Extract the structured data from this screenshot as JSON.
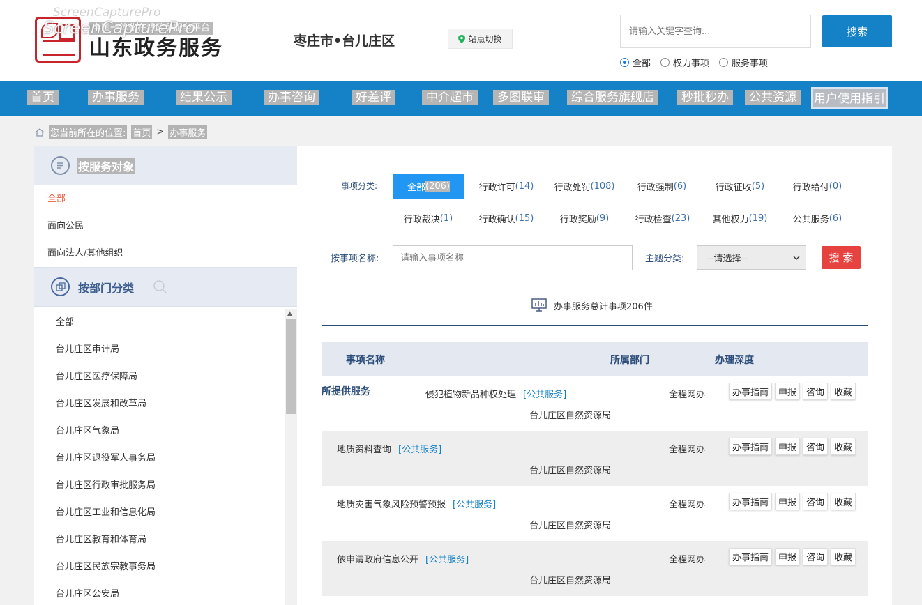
{
  "header": {
    "watermark_top": "ScreenCapturePro",
    "watermark": "ScreenCapturePro",
    "logo_subtitle": "全国一体化在线政务服务平台",
    "logo_title": "山东政务服务",
    "region": "枣庄市•台儿庄区",
    "site_switch": "站点切换",
    "search_placeholder": "请输入关键字查询...",
    "search_button": "搜索",
    "radios": [
      {
        "label": "全部",
        "checked": true
      },
      {
        "label": "权力事项",
        "checked": false
      },
      {
        "label": "服务事项",
        "checked": false
      }
    ]
  },
  "nav": {
    "items": [
      "首页",
      "办事服务",
      "结果公示",
      "办事咨询",
      "好差评",
      "中介超市",
      "多图联审",
      "综合服务旗舰店",
      "秒批秒办",
      "公共资源"
    ],
    "guide": "用户使用指引"
  },
  "breadcrumb": {
    "prefix": "您当前所在的位置:",
    "home": "首页",
    "sep": ">",
    "current": "办事服务"
  },
  "sidebar": {
    "target_title": "按服务对象",
    "target_items": [
      "全部",
      "面向公民",
      "面向法人/其他组织"
    ],
    "dept_title": "按部门分类",
    "dept_items": [
      "全部",
      "台儿庄区审计局",
      "台儿庄区医疗保障局",
      "台儿庄区发展和改革局",
      "台儿庄区气象局",
      "台儿庄区退役军人事务局",
      "台儿庄区行政审批服务局",
      "台儿庄区工业和信息化局",
      "台儿庄区教育和体育局",
      "台儿庄区民族宗教事务局",
      "台儿庄区公安局"
    ]
  },
  "filters": {
    "category_label": "事项分类:",
    "categories_row1": [
      {
        "name": "全部",
        "count": "(206)"
      },
      {
        "name": "行政许可",
        "count": "(14)"
      },
      {
        "name": "行政处罚",
        "count": "(108)"
      },
      {
        "name": "行政强制",
        "count": "(6)"
      },
      {
        "name": "行政征收",
        "count": "(5)"
      },
      {
        "name": "行政给付",
        "count": "(0)"
      }
    ],
    "categories_row2": [
      {
        "name": "行政裁决",
        "count": "(1)"
      },
      {
        "name": "行政确认",
        "count": "(15)"
      },
      {
        "name": "行政奖励",
        "count": "(9)"
      },
      {
        "name": "行政检查",
        "count": "(23)"
      },
      {
        "name": "其他权力",
        "count": "(19)"
      },
      {
        "name": "公共服务",
        "count": "(6)"
      }
    ],
    "name_label": "按事项名称:",
    "name_placeholder": "请输入事项名称",
    "theme_label": "主题分类:",
    "theme_value": "--请选择--",
    "search_button": "搜 索"
  },
  "summary": {
    "total_text": "办事服务总计事项206件"
  },
  "table": {
    "columns": [
      "事项名称",
      "所属部门",
      "办理深度"
    ],
    "section_label": "所提供服务",
    "rows": [
      {
        "name": "侵犯植物新品种权处理",
        "tag": "[公共服务]",
        "dept": "台儿庄区自然资源局",
        "depth": "全程网办"
      },
      {
        "name": "地质资料查询",
        "tag": "[公共服务]",
        "dept": "台儿庄区自然资源局",
        "depth": "全程网办"
      },
      {
        "name": "地质灾害气象风险预警预报",
        "tag": "[公共服务]",
        "dept": "台儿庄区自然资源局",
        "depth": "全程网办"
      },
      {
        "name": "依申请政府信息公开",
        "tag": "[公共服务]",
        "dept": "台儿庄区自然资源局",
        "depth": "全程网办"
      }
    ],
    "actions": [
      "办事指南",
      "申报",
      "咨询",
      "收藏"
    ]
  }
}
